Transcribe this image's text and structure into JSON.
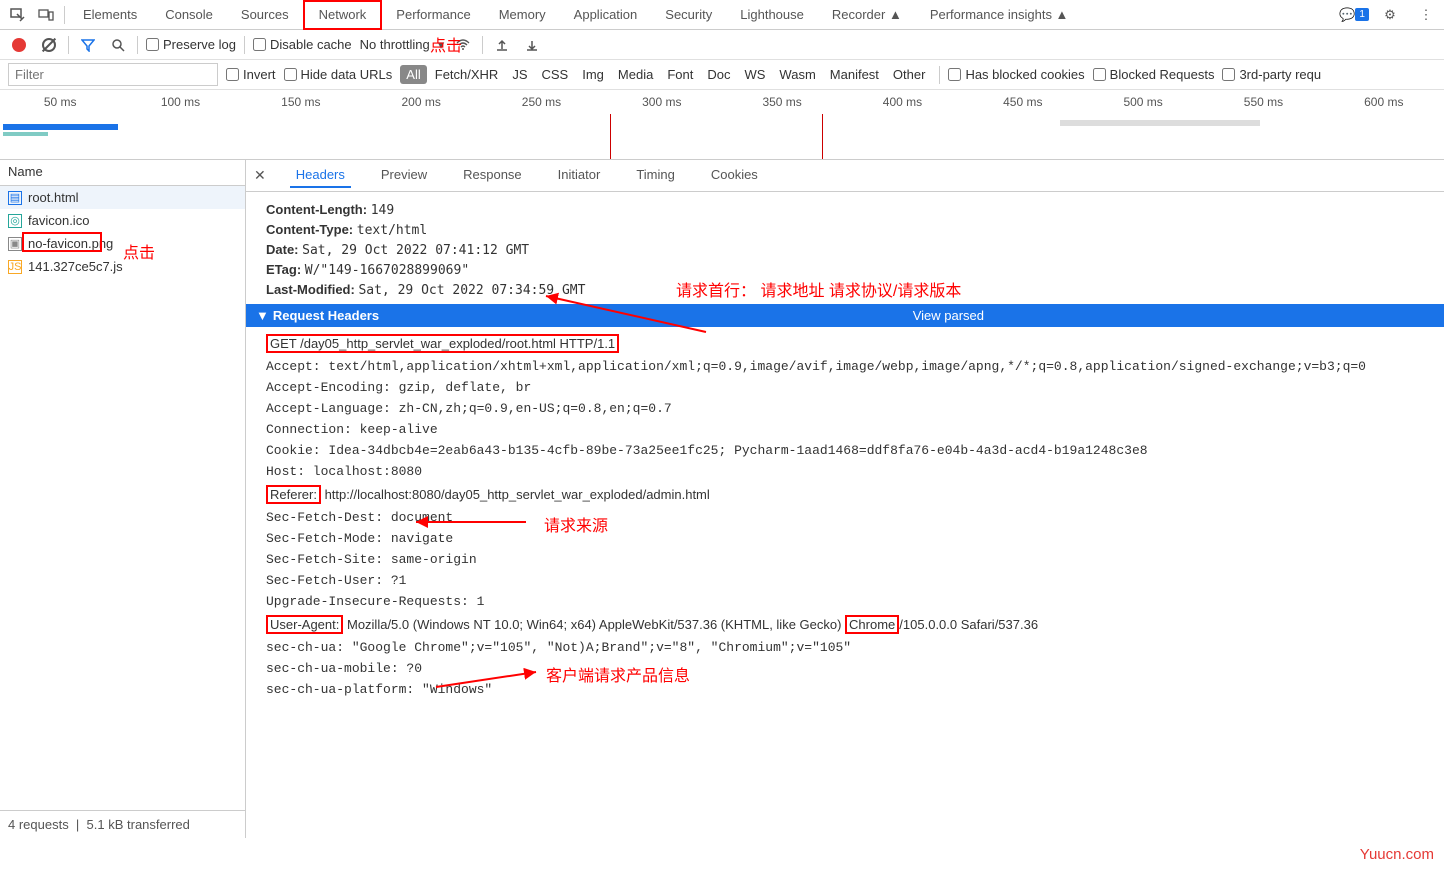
{
  "mainTabs": {
    "items": [
      "Elements",
      "Console",
      "Sources",
      "Network",
      "Performance",
      "Memory",
      "Application",
      "Security",
      "Lighthouse",
      "Recorder ▲",
      "Performance insights ▲"
    ],
    "activeIndex": 3,
    "commentBadge": "1"
  },
  "annotations": {
    "networkClick": "点击",
    "rootClick": "点击",
    "requestFirstLine": "请求首行： 请求地址  请求协议/请求版本",
    "referer": "请求来源",
    "userAgent": "客户端请求产品信息"
  },
  "toolbar": {
    "preserveLog": "Preserve log",
    "disableCache": "Disable cache",
    "throttling": "No throttling"
  },
  "filterRow": {
    "placeholder": "Filter",
    "invert": "Invert",
    "hideData": "Hide data URLs",
    "chips": [
      "All",
      "Fetch/XHR",
      "JS",
      "CSS",
      "Img",
      "Media",
      "Font",
      "Doc",
      "WS",
      "Wasm",
      "Manifest",
      "Other"
    ],
    "activeChipIndex": 0,
    "hasBlocked": "Has blocked cookies",
    "blockedReq": "Blocked Requests",
    "thirdParty": "3rd-party requ"
  },
  "timeline": {
    "ticks": [
      "50 ms",
      "100 ms",
      "150 ms",
      "200 ms",
      "250 ms",
      "300 ms",
      "350 ms",
      "400 ms",
      "450 ms",
      "500 ms",
      "550 ms",
      "600 ms"
    ]
  },
  "nameCol": {
    "header": "Name",
    "rows": [
      {
        "icon": "doc",
        "label": "root.html",
        "sel": true
      },
      {
        "icon": "ico",
        "label": "favicon.ico"
      },
      {
        "icon": "img",
        "label": "no-favicon.png"
      },
      {
        "icon": "js",
        "label": "141.327ce5c7.js"
      }
    ]
  },
  "detailTabs": {
    "items": [
      "Headers",
      "Preview",
      "Response",
      "Initiator",
      "Timing",
      "Cookies"
    ],
    "activeIndex": 0
  },
  "responseHeaders": [
    {
      "k": "Content-Length:",
      "v": "149"
    },
    {
      "k": "Content-Type:",
      "v": "text/html"
    },
    {
      "k": "Date:",
      "v": "Sat, 29 Oct 2022 07:41:12 GMT"
    },
    {
      "k": "ETag:",
      "v": "W/\"149-1667028899069\""
    },
    {
      "k": "Last-Modified:",
      "v": "Sat, 29 Oct 2022 07:34:59 GMT"
    }
  ],
  "requestSection": {
    "title": "Request Headers",
    "viewParsed": "View parsed"
  },
  "requestFirstLine": "GET /day05_http_servlet_war_exploded/root.html HTTP/1.1",
  "requestHeaders": [
    "Accept: text/html,application/xhtml+xml,application/xml;q=0.9,image/avif,image/webp,image/apng,*/*;q=0.8,application/signed-exchange;v=b3;q=0",
    "Accept-Encoding: gzip, deflate, br",
    "Accept-Language: zh-CN,zh;q=0.9,en-US;q=0.8,en;q=0.7",
    "Connection: keep-alive",
    "Cookie: Idea-34dbcb4e=2eab6a43-b135-4cfb-89be-73a25ee1fc25; Pycharm-1aad1468=ddf8fa76-e04b-4a3d-acd4-b19a1248c3e8",
    "Host: localhost:8080"
  ],
  "refererLine": {
    "k": "Referer:",
    "v": " http://localhost:8080/day05_http_servlet_war_exploded/admin.html"
  },
  "requestHeaders2": [
    "Sec-Fetch-Dest: document",
    "Sec-Fetch-Mode: navigate",
    "Sec-Fetch-Site: same-origin",
    "Sec-Fetch-User: ?1",
    "Upgrade-Insecure-Requests: 1"
  ],
  "uaLine": {
    "k": "User-Agent:",
    "mid": " Mozilla/5.0 (Windows NT 10.0; Win64; x64) AppleWebKit/537.36 (KHTML, like Gecko) ",
    "chrome": "Chrome",
    "tail": "/105.0.0.0 Safari/537.36"
  },
  "requestHeaders3": [
    "sec-ch-ua: \"Google Chrome\";v=\"105\", \"Not)A;Brand\";v=\"8\", \"Chromium\";v=\"105\"",
    "sec-ch-ua-mobile: ?0",
    "sec-ch-ua-platform: \"Windows\""
  ],
  "status": {
    "requests": "4 requests",
    "transferred": "5.1 kB transferred"
  },
  "watermark": "Yuucn.com"
}
